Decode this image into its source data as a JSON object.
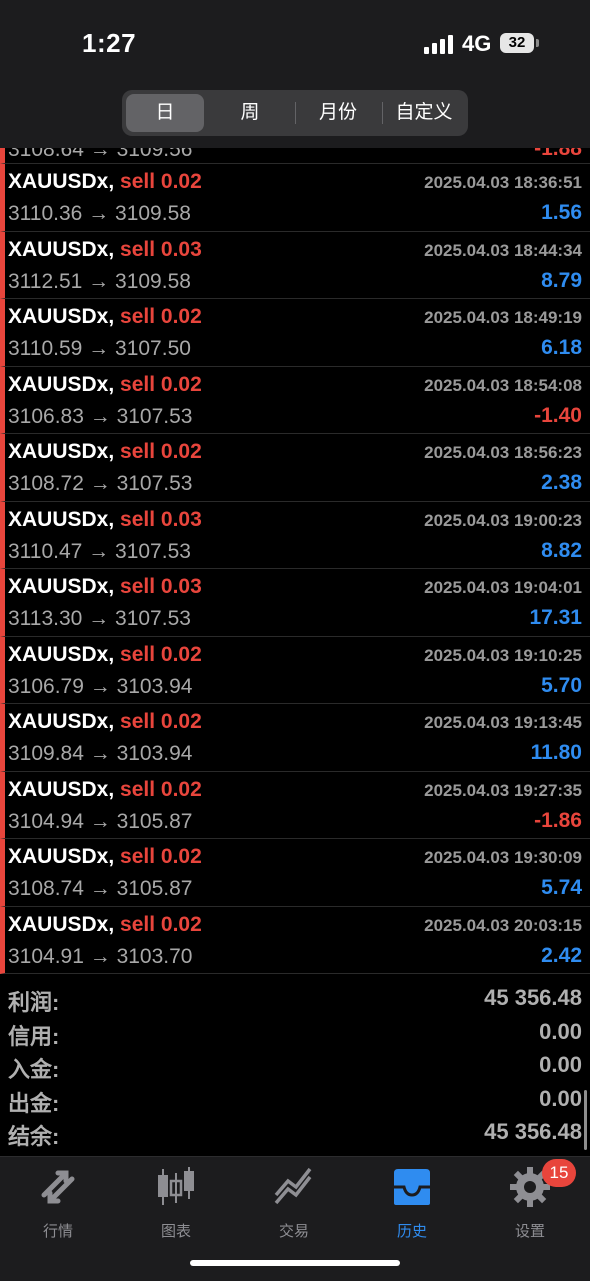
{
  "status_bar": {
    "time": "1:27",
    "network": "4G",
    "battery": "32"
  },
  "period_tabs": [
    "日",
    "周",
    "月份",
    "自定义"
  ],
  "partial_row": {
    "prices": "3108.64 → 3109.56",
    "profit": "-1.88"
  },
  "trades": [
    {
      "symbol": "XAUUSDx,",
      "side": "sell 0.02",
      "datetime": "2025.04.03 18:36:51",
      "prices": "3110.36 → 3109.58",
      "profit": "1.56",
      "positive": true
    },
    {
      "symbol": "XAUUSDx,",
      "side": "sell 0.03",
      "datetime": "2025.04.03 18:44:34",
      "prices": "3112.51 → 3109.58",
      "profit": "8.79",
      "positive": true
    },
    {
      "symbol": "XAUUSDx,",
      "side": "sell 0.02",
      "datetime": "2025.04.03 18:49:19",
      "prices": "3110.59 → 3107.50",
      "profit": "6.18",
      "positive": true
    },
    {
      "symbol": "XAUUSDx,",
      "side": "sell 0.02",
      "datetime": "2025.04.03 18:54:08",
      "prices": "3106.83 → 3107.53",
      "profit": "-1.40",
      "positive": false
    },
    {
      "symbol": "XAUUSDx,",
      "side": "sell 0.02",
      "datetime": "2025.04.03 18:56:23",
      "prices": "3108.72 → 3107.53",
      "profit": "2.38",
      "positive": true
    },
    {
      "symbol": "XAUUSDx,",
      "side": "sell 0.03",
      "datetime": "2025.04.03 19:00:23",
      "prices": "3110.47 → 3107.53",
      "profit": "8.82",
      "positive": true
    },
    {
      "symbol": "XAUUSDx,",
      "side": "sell 0.03",
      "datetime": "2025.04.03 19:04:01",
      "prices": "3113.30 → 3107.53",
      "profit": "17.31",
      "positive": true
    },
    {
      "symbol": "XAUUSDx,",
      "side": "sell 0.02",
      "datetime": "2025.04.03 19:10:25",
      "prices": "3106.79 → 3103.94",
      "profit": "5.70",
      "positive": true
    },
    {
      "symbol": "XAUUSDx,",
      "side": "sell 0.02",
      "datetime": "2025.04.03 19:13:45",
      "prices": "3109.84 → 3103.94",
      "profit": "11.80",
      "positive": true
    },
    {
      "symbol": "XAUUSDx,",
      "side": "sell 0.02",
      "datetime": "2025.04.03 19:27:35",
      "prices": "3104.94 → 3105.87",
      "profit": "-1.86",
      "positive": false
    },
    {
      "symbol": "XAUUSDx,",
      "side": "sell 0.02",
      "datetime": "2025.04.03 19:30:09",
      "prices": "3108.74 → 3105.87",
      "profit": "5.74",
      "positive": true
    },
    {
      "symbol": "XAUUSDx,",
      "side": "sell 0.02",
      "datetime": "2025.04.03 20:03:15",
      "prices": "3104.91 → 3103.70",
      "profit": "2.42",
      "positive": true
    }
  ],
  "summary": [
    {
      "label": "利润:",
      "value": "45 356.48"
    },
    {
      "label": "信用:",
      "value": "0.00"
    },
    {
      "label": "入金:",
      "value": "0.00"
    },
    {
      "label": "出金:",
      "value": "0.00"
    },
    {
      "label": "结余:",
      "value": "45 356.48"
    }
  ],
  "tab_bar": {
    "items": [
      {
        "label": "行情",
        "icon": "arrows-icon"
      },
      {
        "label": "图表",
        "icon": "candlestick-icon"
      },
      {
        "label": "交易",
        "icon": "trade-chart-icon"
      },
      {
        "label": "历史",
        "icon": "inbox-icon"
      },
      {
        "label": "设置",
        "icon": "gear-icon"
      }
    ],
    "active": "历史",
    "badge": "15"
  },
  "colors": {
    "sell": "#e8453c",
    "profit_positive": "#2f8cf0",
    "profit_negative": "#e8453c",
    "active_tab": "#2f8cf0"
  }
}
